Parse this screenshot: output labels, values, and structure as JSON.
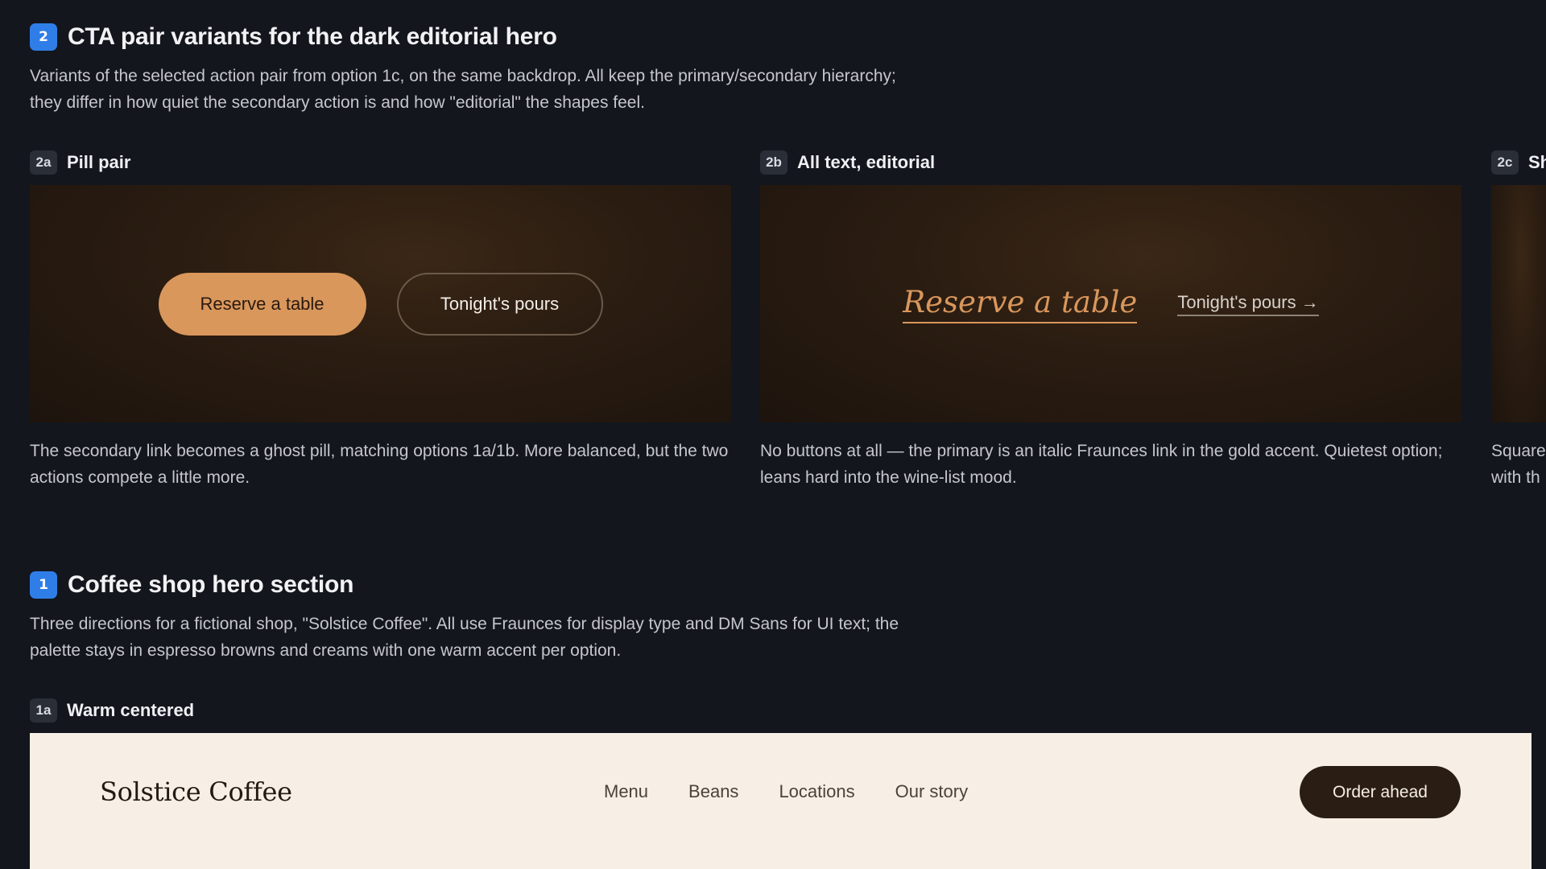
{
  "section2": {
    "badge": "2",
    "title": "CTA pair variants for the dark editorial hero",
    "description": "Variants of the selected action pair from option 1c, on the same backdrop. All keep the primary/secondary hierarchy; they differ in how quiet the secondary action is and how \"editorial\" the shapes feel.",
    "variants": [
      {
        "badge": "2a",
        "title": "Pill pair",
        "primary_label": "Reserve a table",
        "secondary_label": "Tonight's pours",
        "note": "The secondary link becomes a ghost pill, matching options 1a/1b. More balanced, but the two actions compete a little more."
      },
      {
        "badge": "2b",
        "title": "All text, editorial",
        "primary_label": "Reserve a table",
        "secondary_label": "Tonight's pours →",
        "note": "No buttons at all — the primary is an italic Fraunces link in the gold accent. Quietest option; leans hard into the wine-list mood."
      },
      {
        "badge": "2c",
        "title": "Sh",
        "note": "Square\nwith th"
      }
    ]
  },
  "section1": {
    "badge": "1",
    "title": "Coffee shop hero section",
    "description": "Three directions for a fictional shop, \"Solstice Coffee\". All use Fraunces for display type and DM Sans for UI text; the palette stays in espresso browns and creams with one warm accent per option.",
    "variant": {
      "badge": "1a",
      "title": "Warm centered",
      "logo": "Solstice Coffee",
      "nav": [
        "Menu",
        "Beans",
        "Locations",
        "Our story"
      ],
      "cta": "Order ahead"
    }
  },
  "colors": {
    "page_bg": "#13161d",
    "badge_blue": "#2f7ee8",
    "gold_accent": "#d9975c",
    "espresso": "#2a1d14",
    "cream": "#f7efe5"
  }
}
